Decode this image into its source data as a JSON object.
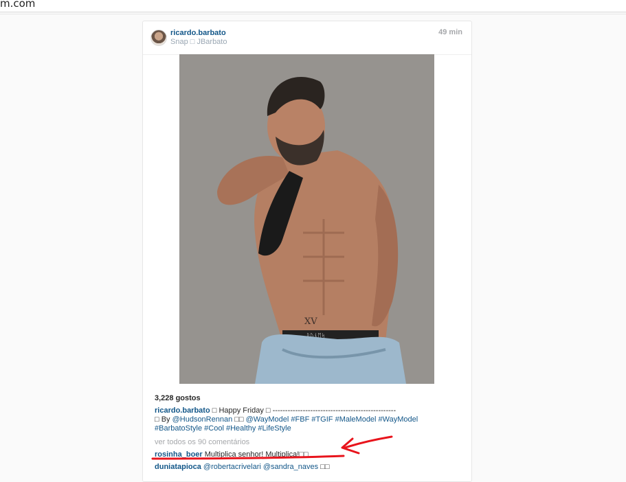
{
  "browser": {
    "url_fragment": "m.com"
  },
  "post": {
    "username": "ricardo.barbato",
    "location": "Snap □ JBarbato",
    "time": "49 min",
    "likes": "3,228 gostos",
    "caption": {
      "username": "ricardo.barbato",
      "line1": " □ Happy Friday □ -------------------------------------------------",
      "line2_prefix": "□ By ",
      "mention_hudson": "@HudsonRennan",
      "sep1": " □□ ",
      "mention_way": "@WayModel",
      "tags_line2": " #FBF #TGIF #MaleModel #WayModel",
      "tags_line3": "#BarbatoStyle #Cool #Healthy #LifeStyle"
    },
    "view_all": "ver todos os 90 comentários",
    "comments": [
      {
        "username": "rosinha_boer",
        "text": " Multiplica senhor! Multiplica!□□"
      },
      {
        "username": "duniatapioca",
        "mention1": " @robertacrivelari",
        "mention2": " @sandra_naves",
        "text": " □□"
      }
    ]
  },
  "annotation": {
    "color": "#e8141c",
    "tattoo_text": "XV",
    "belt_text": "ᚱᚢᚾᛖᛋ"
  }
}
